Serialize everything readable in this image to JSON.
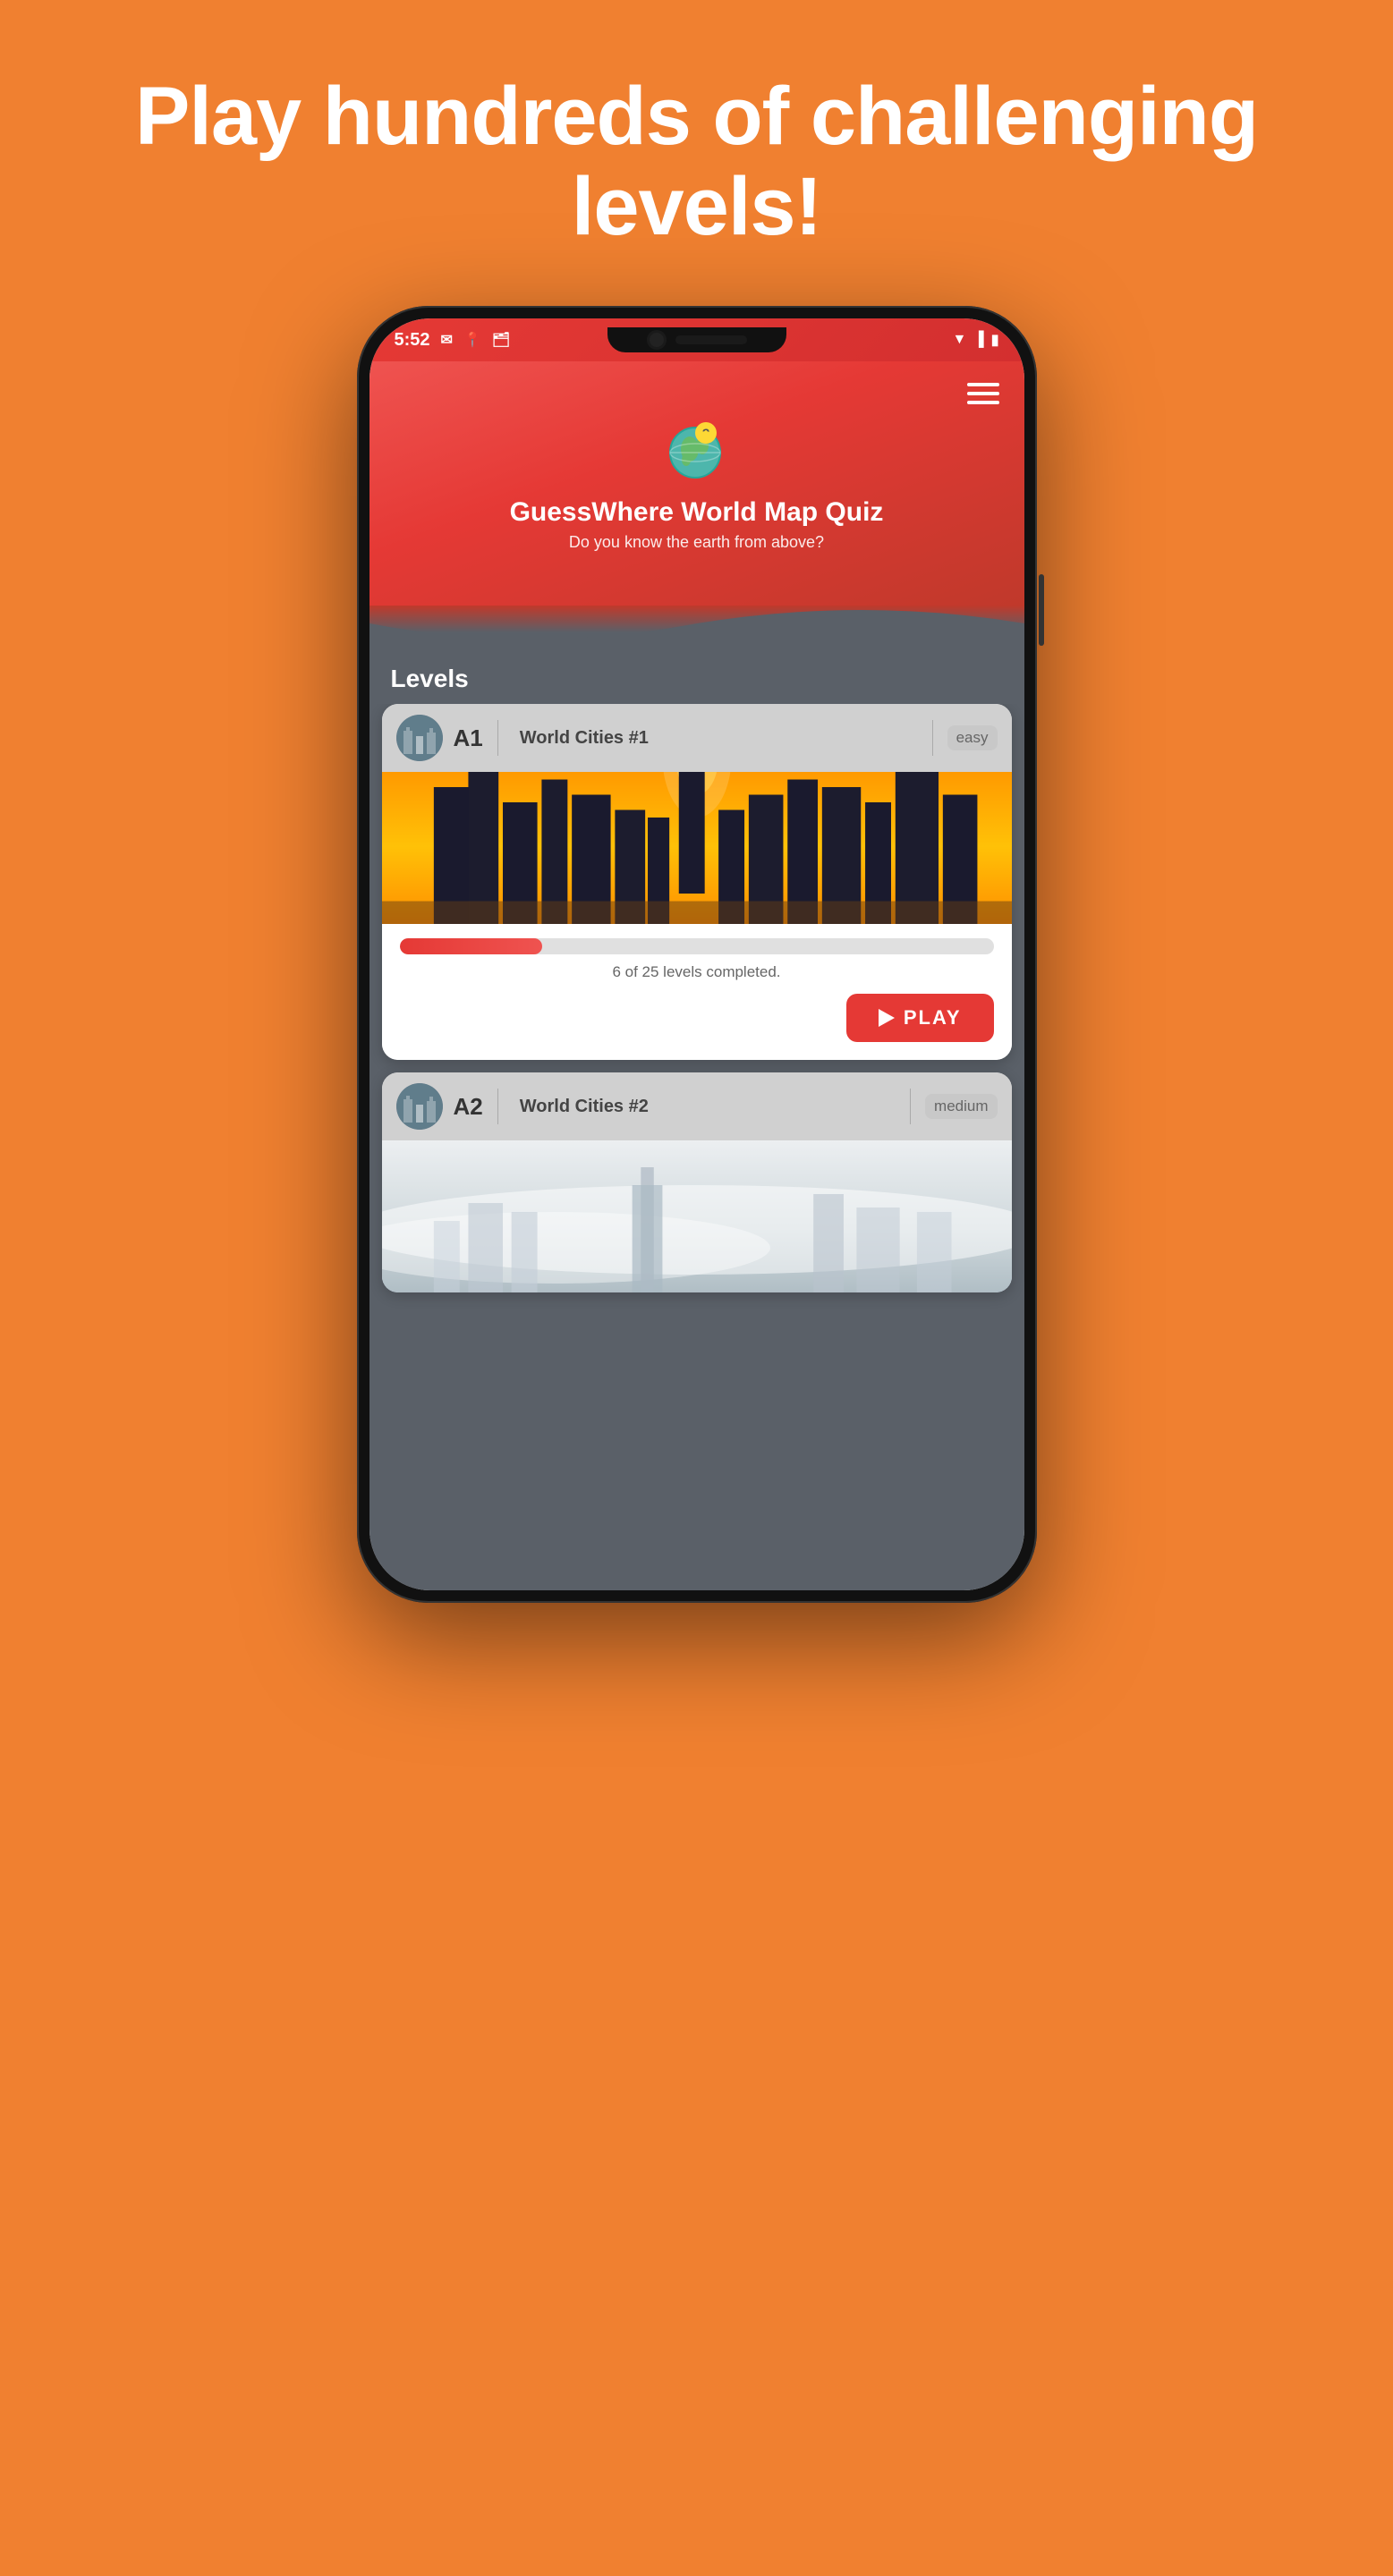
{
  "page": {
    "background_color": "#F08030",
    "hero_text": "Play hundreds of challenging levels!",
    "phone": {
      "status_bar": {
        "time": "5:52",
        "icons_left": [
          "gmail-icon",
          "map-icon",
          "wallet-icon"
        ],
        "icons_right": [
          "wifi-icon",
          "signal-icon",
          "battery-icon"
        ]
      },
      "app_header": {
        "title": "GuessWhere World Map Quiz",
        "subtitle": "Do you know the earth from above?",
        "menu_icon": "hamburger-icon"
      },
      "levels_section": {
        "section_title": "Levels",
        "levels": [
          {
            "id": "A1",
            "name": "World Cities #1",
            "difficulty": "easy",
            "progress_text": "6 of 25 levels completed.",
            "progress_percent": 24,
            "play_button_label": "PLAY",
            "image_type": "dubai-sunset"
          },
          {
            "id": "A2",
            "name": "World Cities #2",
            "difficulty": "medium",
            "image_type": "city-fog"
          }
        ]
      }
    }
  }
}
